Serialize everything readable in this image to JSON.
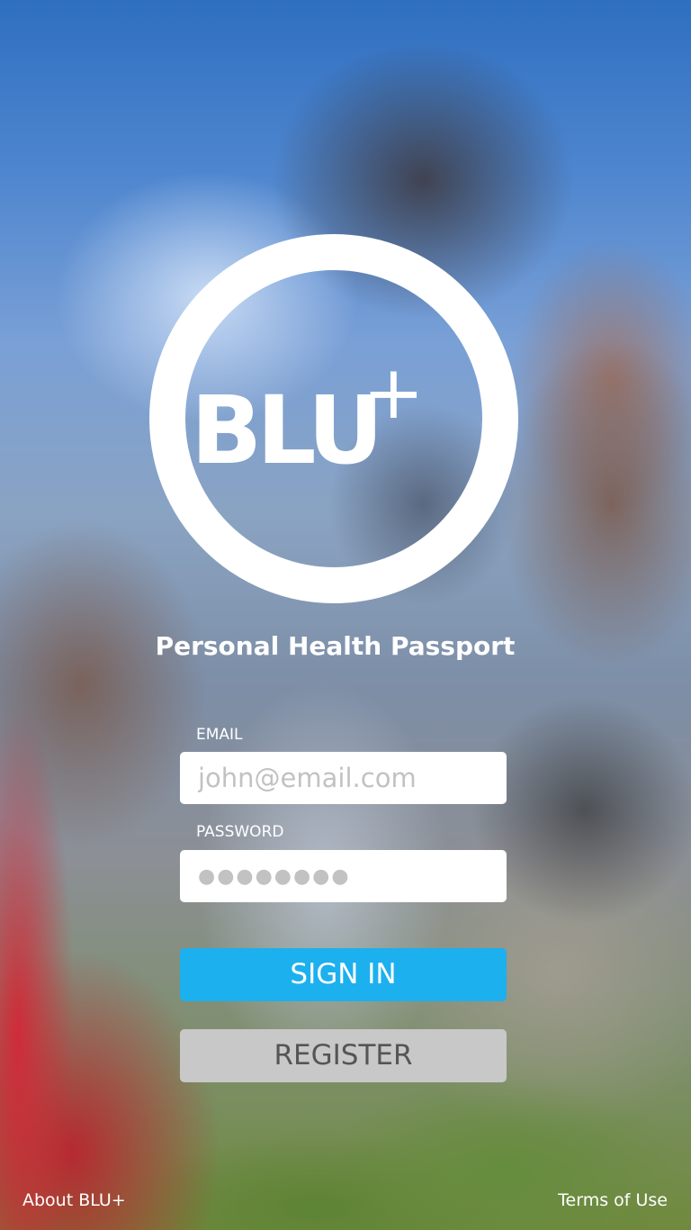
{
  "logo": {
    "text": "BLU",
    "superscript": "+"
  },
  "tagline": "Personal Health Passport",
  "form": {
    "email_label": "EMAIL",
    "email_placeholder": "john@email.com",
    "email_value": "",
    "password_label": "PASSWORD",
    "password_placeholder": "●●●●●●●●",
    "password_value": ""
  },
  "buttons": {
    "sign_in": "SIGN IN",
    "register": "REGISTER"
  },
  "footer": {
    "about": "About BLU+",
    "terms": "Terms of Use"
  },
  "colors": {
    "sign_in_bg": "#1cb0ee",
    "register_bg": "#c8c8c8",
    "register_text": "#555555",
    "logo": "#ffffff"
  }
}
